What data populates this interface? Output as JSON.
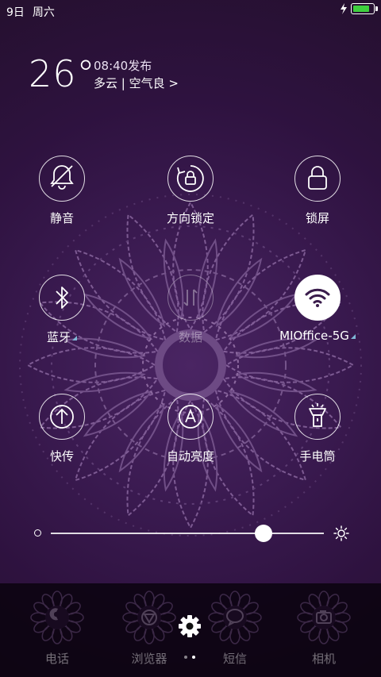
{
  "status_bar": {
    "date": "9日",
    "weekday": "周六",
    "battery_level": 0.85,
    "battery_color": "#3ecf3e"
  },
  "weather": {
    "temperature": "26°",
    "published": "08:40发布",
    "condition": "多云 | 空气良 >"
  },
  "toggles": [
    {
      "label": "静音",
      "icon": "bell-off-icon",
      "state": "off"
    },
    {
      "label": "方向锁定",
      "icon": "rotation-lock-icon",
      "state": "off"
    },
    {
      "label": "锁屏",
      "icon": "lock-icon",
      "state": "off"
    },
    {
      "label": "蓝牙",
      "icon": "bluetooth-icon",
      "state": "off"
    },
    {
      "label": "数据",
      "icon": "mobile-data-icon",
      "state": "disabled"
    },
    {
      "label": "MIOffice-5G",
      "icon": "wifi-icon",
      "state": "on"
    },
    {
      "label": "快传",
      "icon": "upload-icon",
      "state": "off"
    },
    {
      "label": "自动亮度",
      "icon": "auto-brightness-icon",
      "state": "off"
    },
    {
      "label": "手电筒",
      "icon": "flashlight-icon",
      "state": "off"
    }
  ],
  "brightness": {
    "level": 0.78
  },
  "dock": {
    "items": [
      {
        "label": "电话",
        "icon": "phone-icon"
      },
      {
        "label": "浏览器",
        "icon": "browser-icon"
      },
      {
        "label": "短信",
        "icon": "message-icon"
      },
      {
        "label": "相机",
        "icon": "camera-icon"
      }
    ],
    "settings_icon": "gear-icon",
    "page_count": 2,
    "current_page": 2
  },
  "colors": {
    "background": "#2f1440",
    "accent_wifi": "#ffffff",
    "signal_triangle": "#7fb8d6"
  }
}
